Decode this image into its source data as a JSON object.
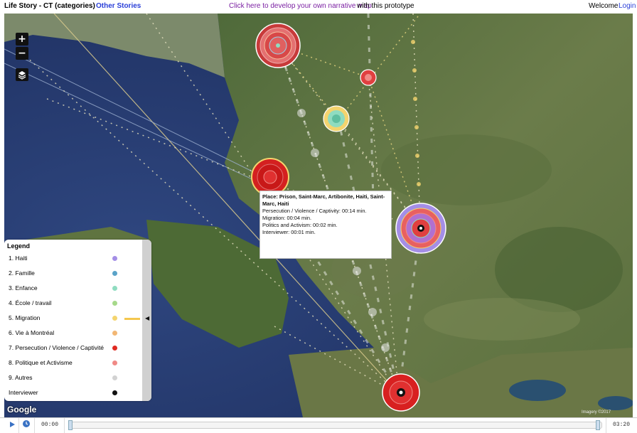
{
  "header": {
    "title": "Life Story - CT (categories)",
    "other_stories": "Other Stories",
    "develop_link": "Click here to develop your own narrative map",
    "develop_rest": "with this prototype",
    "welcome": "Welcome",
    "login": "Login"
  },
  "map": {
    "zoom_in": "+",
    "zoom_out": "−",
    "google": "Google",
    "attribution": "Imagery ©2017"
  },
  "tooltip": {
    "place": "Place: Prison, Saint-Marc, Artibonite, Haiti, Saint-Marc, Haiti",
    "lines": [
      "Persecution / Violence / Captivity: 00:14 min.",
      "Migration: 00:04 min.",
      "Politics and Activism: 00:02 min.",
      "Interviewer: 00:01 min."
    ]
  },
  "legend": {
    "title": "Legend",
    "items": [
      {
        "label": "1. Haiti",
        "color": "#a48ee6"
      },
      {
        "label": "2. Famille",
        "color": "#5aa3c8"
      },
      {
        "label": "3. Enfance",
        "color": "#8fdcc0"
      },
      {
        "label": "4. École / travail",
        "color": "#a6d98a"
      },
      {
        "label": "5. Migration",
        "color": "#f4d46e"
      },
      {
        "label": "6. Vie à Montréal",
        "color": "#f2b774"
      },
      {
        "label": "7. Persecution / Violence / Captivité",
        "color": "#e02a22"
      },
      {
        "label": "8. Politique et Activisme",
        "color": "#f08a86"
      },
      {
        "label": "9. Autres",
        "color": "#d2d2d2"
      },
      {
        "label": "Interviewer",
        "color": "#111111"
      }
    ]
  },
  "timeline": {
    "start": "00:00",
    "end": "03:20",
    "progress": 0
  }
}
